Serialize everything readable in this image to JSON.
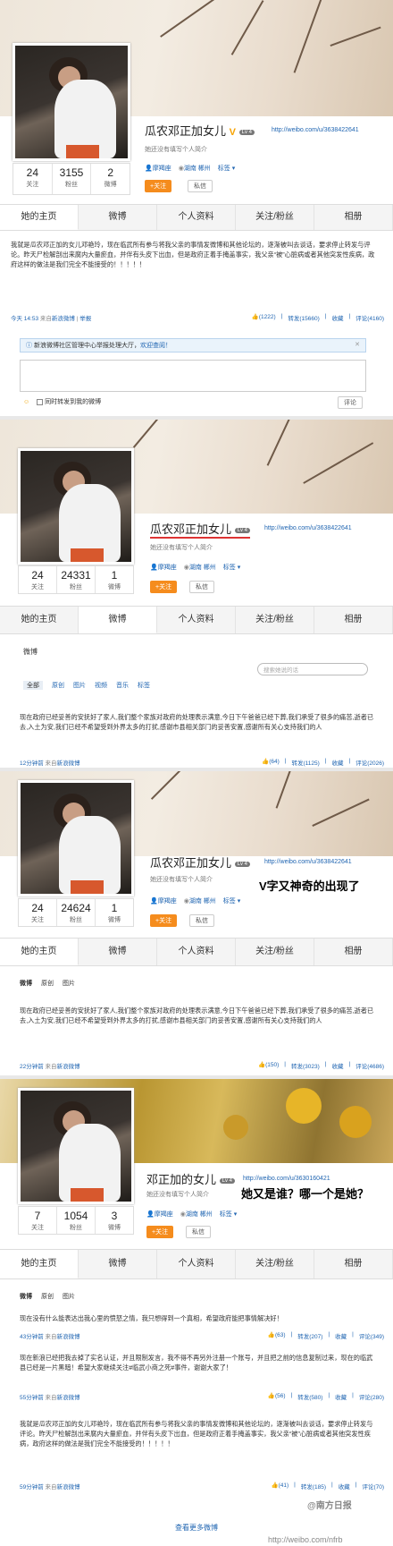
{
  "common": {
    "url": "http://weibo.com/u/3638422641",
    "intro": "她还没有填写个人简介",
    "loc_a": "摩羯座",
    "loc_b": "湖南 郴州",
    "tag": "标签",
    "follow": "+关注",
    "message": "私信",
    "lv": "Lv 4",
    "v_mark": "V",
    "lbl_follow": "关注",
    "lbl_fans": "粉丝",
    "lbl_weibo": "微博",
    "tabs": [
      "她的主页",
      "微博",
      "个人资料",
      "关注/粉丝",
      "相册"
    ]
  },
  "panel1": {
    "name": "瓜农邓正加女儿",
    "counts": [
      "24",
      "3155",
      "2"
    ],
    "post": "我就是瓜农邓正加的女儿邓艳玲，现在临武所有参与将我父亲的事情发微博和其他论坛的，逐渐被叫去谈话，要求停止转发与评论。昨天尸检解剖出来腐内大量瘀血，并伴有头皮下出血，但是政府正着手掩盖事实，我父亲“被”心脏病或者其他突发性疾病，政府这样的做法是我们完全不能接受的！！！！！",
    "time": "今天 14:53",
    "source_pre": "来自",
    "source": "新浪微博",
    "report": "举报",
    "like": "(1222)",
    "repost": "转发(15660)",
    "fav": "收藏",
    "comment": "评论(4160)",
    "notice_pre": "新浪微博社区管理中心举报处理大厅，",
    "notice_link": "欢迎查阅！",
    "also_forward": "同时转发到我的微博",
    "comment_btn": "评论"
  },
  "panel2": {
    "name": "瓜农邓正加女儿",
    "url": "http://weibo.com/u/3638422641",
    "counts": [
      "24",
      "24331",
      "1"
    ],
    "section": "微博",
    "search": "搜索她说的话",
    "filters": [
      "全部",
      "原创",
      "图片",
      "视频",
      "音乐",
      "标签"
    ],
    "post": "现在政府已经妥善的安抚好了家人,我们整个家族对政府的处理表示满意,今日下午爸爸已经下葬,我们承受了很多的痛苦,逝者已去,入土为安,我们已经不希望受到外界太多的打扰,感谢市县相关部门的妥善安置,感谢所有关心支持我们的人",
    "time": "12分钟前",
    "source_pre": "来自",
    "source": "新浪微博",
    "like": "(64)",
    "repost": "转发(1125)",
    "fav": "收藏",
    "comment": "评论(2026)"
  },
  "panel3": {
    "name": "瓜农邓正加女儿",
    "url": "http://weibo.com/u/3638422641",
    "counts": [
      "24",
      "24624",
      "1"
    ],
    "overlay": "V字又神奇的出现了",
    "subnav": [
      "微博",
      "原创",
      "图片"
    ],
    "post": "现在政府已经妥善的安抚好了家人,我们整个家族对政府的处理表示满意,今日下午爸爸已经下葬,我们承受了很多的痛苦,逝者已去,入土为安,我们已经不希望受到外界太多的打扰,感谢市县相关部门的妥善安置,感谢所有关心支持我们的人",
    "time": "22分钟前",
    "source_pre": "来自",
    "source": "新浪微博",
    "like": "(150)",
    "repost": "转发(3023)",
    "fav": "收藏",
    "comment": "评论(4686)"
  },
  "panel4": {
    "name": "邓正加的女儿",
    "url": "http://weibo.com/u/3630160421",
    "counts": [
      "7",
      "1054",
      "3"
    ],
    "overlay": "她又是谁？哪一个是她？",
    "subnav": [
      "微博",
      "原创",
      "图片"
    ],
    "posts": [
      {
        "text": "现在没有什么能表达出我心里的愤怒之情，我只想得到一个真相，希望政府能把事情解决好！",
        "time": "43分钟前",
        "like": "(63)",
        "repost": "转发(207)",
        "comment": "评论(349)"
      },
      {
        "text": "现在新浪已经把我去掉了实名认证，并且限制发言，我不得不再另外注册一个账号，并且把之前的信息复制过来，现在的临武县已经是一片黑暗！希望大家继续关注#临武小商之死#事件，谢谢大家了！",
        "time": "55分钟前",
        "like": "(56)",
        "repost": "转发(580)",
        "comment": "评论(280)"
      },
      {
        "text": "我就是瓜农邓正加的女儿邓艳玲，现在临武所有参与将我父亲的事情发微博和其他论坛的，逐渐被叫去谈话，要求停止转发与评论。昨天尸检解剖出来腐内大量瘀血，并伴有头皮下出血，但是政府正着手掩盖事实，我父亲“被”心脏病或者其他突发性疾病，政府这样的做法是我们完全不能接受的！！！！！",
        "time": "59分钟前",
        "like": "(41)",
        "repost": "转发(185)",
        "comment": "评论(70)"
      }
    ],
    "source_pre": "来自",
    "source": "新浪微博",
    "fav": "收藏",
    "more": "查看更多微博",
    "watermark": "@南方日报",
    "watermark_url": "http://weibo.com/nfrb"
  }
}
